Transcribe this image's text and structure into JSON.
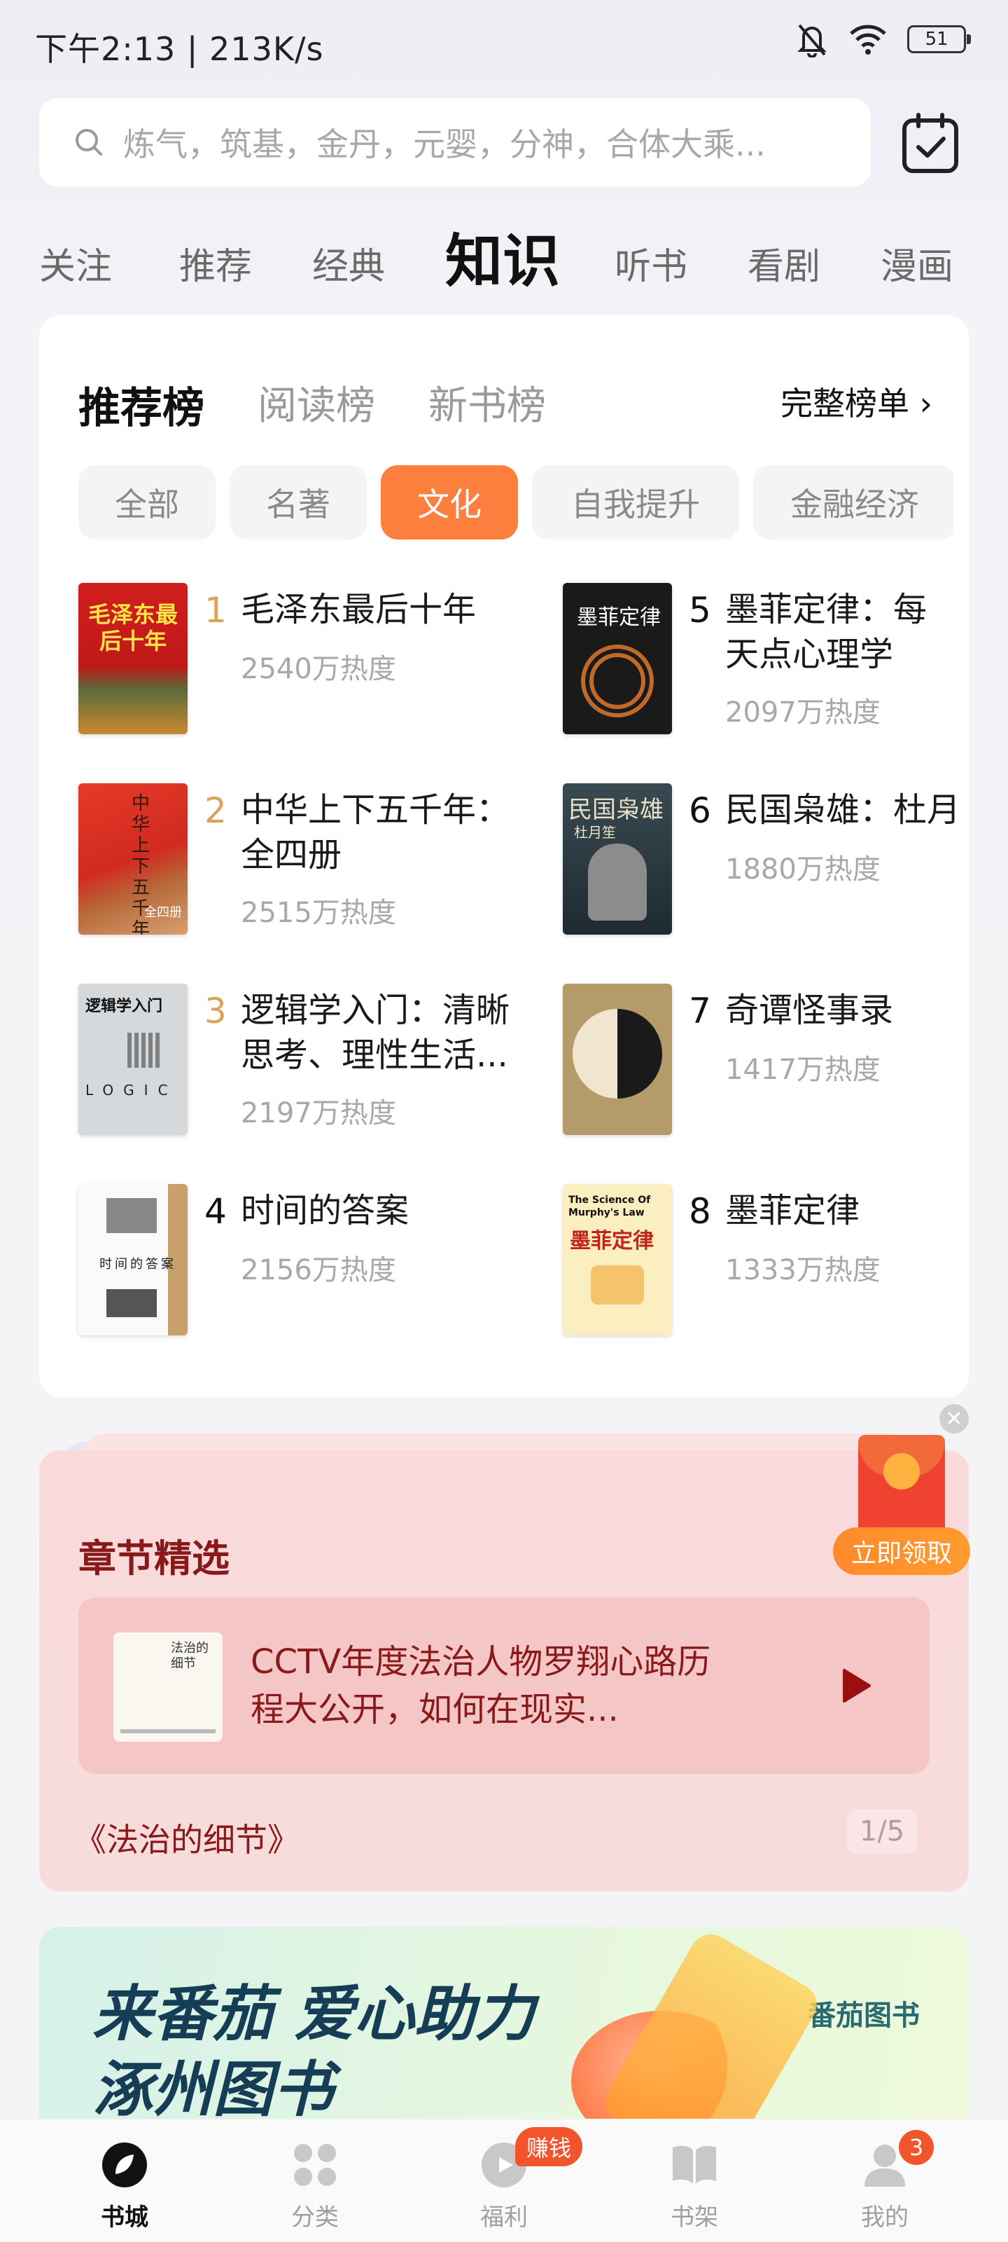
{
  "status_bar": {
    "left_text": "下午2:13 | 213K/s",
    "battery": "51"
  },
  "search": {
    "placeholder": "炼气，筑基，金丹，元婴，分神，合体大乘..."
  },
  "top_tabs": [
    {
      "label": "关注"
    },
    {
      "label": "推荐"
    },
    {
      "label": "经典"
    },
    {
      "label": "知识",
      "active": true
    },
    {
      "label": "听书"
    },
    {
      "label": "看剧"
    },
    {
      "label": "漫画"
    }
  ],
  "ranking": {
    "tabs": [
      {
        "label": "推荐榜",
        "active": true
      },
      {
        "label": "阅读榜"
      },
      {
        "label": "新书榜"
      }
    ],
    "full_list": "完整榜单 ›",
    "chips": [
      {
        "label": "全部"
      },
      {
        "label": "名著"
      },
      {
        "label": "文化",
        "active": true
      },
      {
        "label": "自我提升"
      },
      {
        "label": "金融经济"
      }
    ],
    "books": [
      {
        "rank": "1",
        "title": "毛泽东最后十年",
        "heat": "2540万热度"
      },
      {
        "rank": "2",
        "title": "中华上下五千年：全四册",
        "heat": "2515万热度"
      },
      {
        "rank": "3",
        "title": "逻辑学入门：清晰思考、理性生活...",
        "heat": "2197万热度"
      },
      {
        "rank": "4",
        "title": "时间的答案",
        "heat": "2156万热度"
      },
      {
        "rank": "5",
        "title": "墨菲定律：每天点心理学",
        "heat": "2097万热度"
      },
      {
        "rank": "6",
        "title": "民国枭雄：杜月",
        "heat": "1880万热度"
      },
      {
        "rank": "7",
        "title": "奇谭怪事录",
        "heat": "1417万热度"
      },
      {
        "rank": "8",
        "title": "墨菲定律",
        "heat": "1333万热度"
      }
    ],
    "covers": {
      "c1": "毛泽东最后十年",
      "c2": "中华上下五千年",
      "c2b": "全四册",
      "c3a": "逻辑学入门",
      "c3b": "LOGIC",
      "c4": "时间的答案",
      "c5": "墨菲定律",
      "c6": "民国枭雄",
      "c6b": "杜月笙",
      "c8a": "The Science Of Murphy's Law",
      "c8b": "墨菲定律"
    }
  },
  "chapter": {
    "title": "章节精选",
    "item_text": "CCTV年度法治人物罗翔心路历程大公开，如何在现实...",
    "book": "《法治的细节》",
    "page": "1/5",
    "cover_text": "法治的细节",
    "claim": "立即领取"
  },
  "banner": {
    "line1": "来番茄 爱心助力",
    "line2": "涿州图书",
    "brand": "番茄图书"
  },
  "bottom_nav": [
    {
      "label": "书城",
      "active": true
    },
    {
      "label": "分类"
    },
    {
      "label": "福利"
    },
    {
      "label": "书架"
    },
    {
      "label": "我的"
    }
  ],
  "badges": {
    "earn": "赚钱",
    "count": "3"
  },
  "colors": {
    "accent": "#fd7f3e",
    "rank_gold": "#d9a35b",
    "chapter_text": "#8a1a1a"
  }
}
